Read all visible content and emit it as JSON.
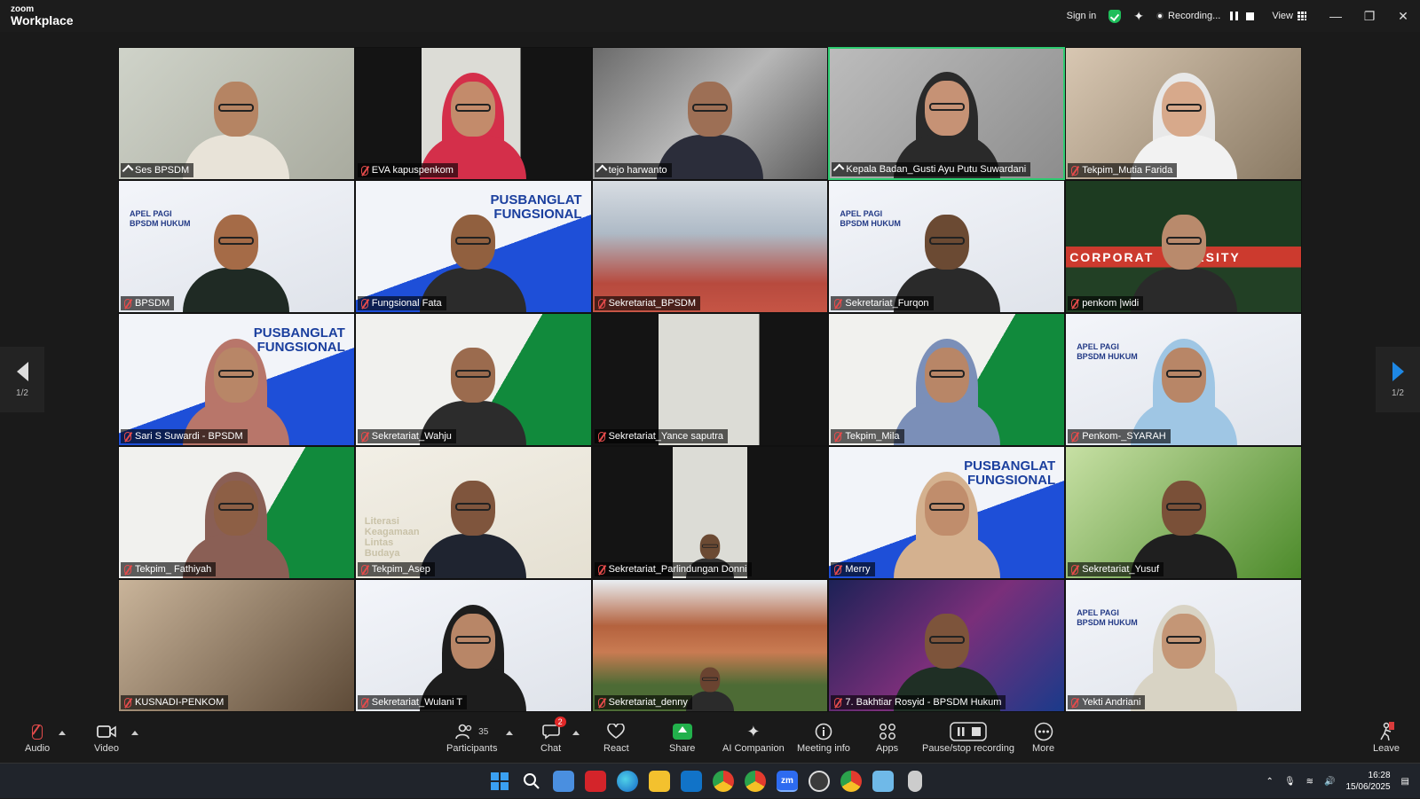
{
  "app": {
    "brand_top": "zoom",
    "brand_bottom": "Workplace"
  },
  "titlebar": {
    "sign_in": "Sign in",
    "recording": "Recording...",
    "view": "View"
  },
  "colors": {
    "accent_green": "#2ecc71",
    "mic_muted": "#e34b4b",
    "share_green": "#22b14c",
    "nav_arrow": "#1e88e5"
  },
  "participants": [
    {
      "name": "Ses BPSDM",
      "icon": "pin-icon"
    },
    {
      "name": "EVA kapuspenkom",
      "icon": "mic-muted-icon"
    },
    {
      "name": "tejo harwanto",
      "icon": "pin-icon"
    },
    {
      "name": "Kepala Badan_Gusti Ayu Putu Suwardani",
      "icon": "pin-icon",
      "active": true
    },
    {
      "name": "Tekpim_Mutia Farida",
      "icon": "mic-muted-icon"
    },
    {
      "name": "BPSDM",
      "icon": "mic-muted-icon",
      "banner": "APEL PAGI\nBPSDM HUKUM"
    },
    {
      "name": "Fungsional Fata",
      "icon": "mic-muted-icon",
      "banner": "PUSBANGLAT\nFUNGSIONAL"
    },
    {
      "name": "Sekretariat_BPSDM",
      "icon": "mic-muted-icon"
    },
    {
      "name": "Sekretariat_Furqon",
      "icon": "mic-muted-icon",
      "banner": "APEL PAGI\nBPSDM HUKUM"
    },
    {
      "name": "penkom |widi",
      "icon": "mic-muted-icon",
      "banner": "CORPORAT    VERSITY"
    },
    {
      "name": "Sari S Suwardi - BPSDM",
      "icon": "mic-muted-icon",
      "banner": "PUSBANGLAT\nFUNGSIONAL"
    },
    {
      "name": "Sekretariat_Wahju",
      "icon": "mic-muted-icon"
    },
    {
      "name": "Sekretariat_Yance saputra",
      "icon": "mic-muted-icon"
    },
    {
      "name": "Tekpim_Mila",
      "icon": "mic-muted-icon"
    },
    {
      "name": "Penkom-_SYARAH",
      "icon": "mic-muted-icon",
      "banner": "APEL PAGI\nBPSDM HUKUM"
    },
    {
      "name": "Tekpim_ Fathiyah",
      "icon": "mic-muted-icon"
    },
    {
      "name": "Tekpim_Asep",
      "icon": "mic-muted-icon",
      "banner": "Literasi\nKeagamaan\nLintas\nBudaya"
    },
    {
      "name": "Sekretariat_Parlindungan Donni",
      "icon": "mic-muted-icon"
    },
    {
      "name": "Merry",
      "icon": "mic-muted-icon",
      "banner": "PUSBANGLAT\nFUNGSIONAL"
    },
    {
      "name": "Sekretariat_Yusuf",
      "icon": "mic-muted-icon"
    },
    {
      "name": "KUSNADI-PENKOM",
      "icon": "mic-muted-icon"
    },
    {
      "name": "Sekretariat_Wulani T",
      "icon": "mic-muted-icon"
    },
    {
      "name": "Sekretariat_denny",
      "icon": "mic-muted-icon"
    },
    {
      "name": "7. Bakhtiar Rosyid - BPSDM Hukum",
      "icon": "mic-muted-icon"
    },
    {
      "name": "Yekti Andriani",
      "icon": "mic-muted-icon",
      "banner": "APEL PAGI\nBPSDM HUKUM"
    }
  ],
  "pagination": {
    "prev_label": "1/2",
    "next_label": "1/2"
  },
  "toolbar": {
    "audio": "Audio",
    "video": "Video",
    "participants": "Participants",
    "participants_count": "35",
    "chat": "Chat",
    "chat_badge": "2",
    "react": "React",
    "share": "Share",
    "ai_companion": "AI Companion",
    "meeting_info": "Meeting info",
    "apps": "Apps",
    "pause_stop_recording": "Pause/stop recording",
    "more": "More",
    "leave": "Leave"
  },
  "taskbar": {
    "time": "16:28",
    "date": "15/06/2025"
  }
}
